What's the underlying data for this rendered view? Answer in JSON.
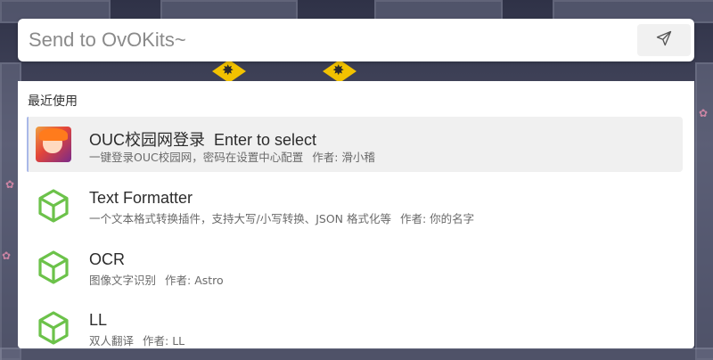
{
  "search": {
    "placeholder": "Send to OvOKits~",
    "value": ""
  },
  "icons": {
    "send": "paper-plane-icon",
    "plugin": "cube-icon",
    "avatar": "anime-avatar-icon"
  },
  "colors": {
    "accent_plugin_icon": "#6cc24a",
    "selected_bar": "#a9b8e8",
    "selected_bg": "#f0f0f0"
  },
  "results": {
    "section_title": "最近使用",
    "items": [
      {
        "name": "OUC校园网登录",
        "hint": "Enter to select",
        "description": "一键登录OUC校园网，密码在设置中心配置",
        "author": "作者: 滑小稽",
        "icon": "anime-avatar-icon",
        "selected": true
      },
      {
        "name": "Text Formatter",
        "hint": "",
        "description": "一个文本格式转换插件，支持大写/小写转换、JSON 格式化等",
        "author": "作者: 你的名字",
        "icon": "cube-icon",
        "selected": false
      },
      {
        "name": "OCR",
        "hint": "",
        "description": "图像文字识别",
        "author": "作者: Astro",
        "icon": "cube-icon",
        "selected": false
      },
      {
        "name": "LL",
        "hint": "",
        "description": "双人翻译",
        "author": "作者: LL",
        "icon": "cube-icon",
        "selected": false
      }
    ]
  }
}
